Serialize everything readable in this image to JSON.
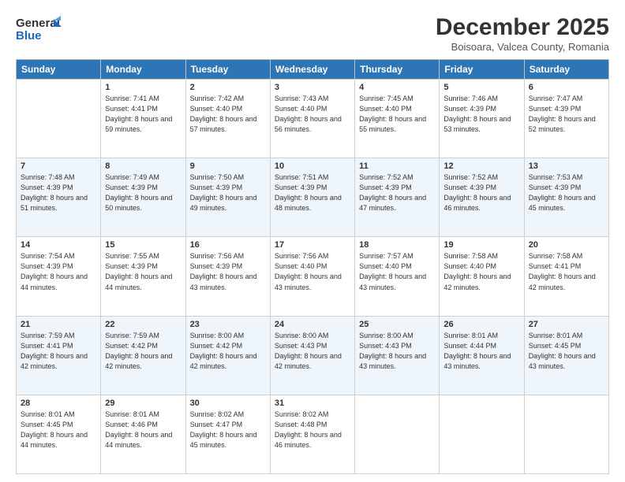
{
  "logo": {
    "line1": "General",
    "line2": "Blue"
  },
  "title": "December 2025",
  "subtitle": "Boisoara, Valcea County, Romania",
  "headers": [
    "Sunday",
    "Monday",
    "Tuesday",
    "Wednesday",
    "Thursday",
    "Friday",
    "Saturday"
  ],
  "weeks": [
    [
      {
        "day": "",
        "sunrise": "",
        "sunset": "",
        "daylight": ""
      },
      {
        "day": "1",
        "sunrise": "Sunrise: 7:41 AM",
        "sunset": "Sunset: 4:41 PM",
        "daylight": "Daylight: 8 hours and 59 minutes."
      },
      {
        "day": "2",
        "sunrise": "Sunrise: 7:42 AM",
        "sunset": "Sunset: 4:40 PM",
        "daylight": "Daylight: 8 hours and 57 minutes."
      },
      {
        "day": "3",
        "sunrise": "Sunrise: 7:43 AM",
        "sunset": "Sunset: 4:40 PM",
        "daylight": "Daylight: 8 hours and 56 minutes."
      },
      {
        "day": "4",
        "sunrise": "Sunrise: 7:45 AM",
        "sunset": "Sunset: 4:40 PM",
        "daylight": "Daylight: 8 hours and 55 minutes."
      },
      {
        "day": "5",
        "sunrise": "Sunrise: 7:46 AM",
        "sunset": "Sunset: 4:39 PM",
        "daylight": "Daylight: 8 hours and 53 minutes."
      },
      {
        "day": "6",
        "sunrise": "Sunrise: 7:47 AM",
        "sunset": "Sunset: 4:39 PM",
        "daylight": "Daylight: 8 hours and 52 minutes."
      }
    ],
    [
      {
        "day": "7",
        "sunrise": "Sunrise: 7:48 AM",
        "sunset": "Sunset: 4:39 PM",
        "daylight": "Daylight: 8 hours and 51 minutes."
      },
      {
        "day": "8",
        "sunrise": "Sunrise: 7:49 AM",
        "sunset": "Sunset: 4:39 PM",
        "daylight": "Daylight: 8 hours and 50 minutes."
      },
      {
        "day": "9",
        "sunrise": "Sunrise: 7:50 AM",
        "sunset": "Sunset: 4:39 PM",
        "daylight": "Daylight: 8 hours and 49 minutes."
      },
      {
        "day": "10",
        "sunrise": "Sunrise: 7:51 AM",
        "sunset": "Sunset: 4:39 PM",
        "daylight": "Daylight: 8 hours and 48 minutes."
      },
      {
        "day": "11",
        "sunrise": "Sunrise: 7:52 AM",
        "sunset": "Sunset: 4:39 PM",
        "daylight": "Daylight: 8 hours and 47 minutes."
      },
      {
        "day": "12",
        "sunrise": "Sunrise: 7:52 AM",
        "sunset": "Sunset: 4:39 PM",
        "daylight": "Daylight: 8 hours and 46 minutes."
      },
      {
        "day": "13",
        "sunrise": "Sunrise: 7:53 AM",
        "sunset": "Sunset: 4:39 PM",
        "daylight": "Daylight: 8 hours and 45 minutes."
      }
    ],
    [
      {
        "day": "14",
        "sunrise": "Sunrise: 7:54 AM",
        "sunset": "Sunset: 4:39 PM",
        "daylight": "Daylight: 8 hours and 44 minutes."
      },
      {
        "day": "15",
        "sunrise": "Sunrise: 7:55 AM",
        "sunset": "Sunset: 4:39 PM",
        "daylight": "Daylight: 8 hours and 44 minutes."
      },
      {
        "day": "16",
        "sunrise": "Sunrise: 7:56 AM",
        "sunset": "Sunset: 4:39 PM",
        "daylight": "Daylight: 8 hours and 43 minutes."
      },
      {
        "day": "17",
        "sunrise": "Sunrise: 7:56 AM",
        "sunset": "Sunset: 4:40 PM",
        "daylight": "Daylight: 8 hours and 43 minutes."
      },
      {
        "day": "18",
        "sunrise": "Sunrise: 7:57 AM",
        "sunset": "Sunset: 4:40 PM",
        "daylight": "Daylight: 8 hours and 43 minutes."
      },
      {
        "day": "19",
        "sunrise": "Sunrise: 7:58 AM",
        "sunset": "Sunset: 4:40 PM",
        "daylight": "Daylight: 8 hours and 42 minutes."
      },
      {
        "day": "20",
        "sunrise": "Sunrise: 7:58 AM",
        "sunset": "Sunset: 4:41 PM",
        "daylight": "Daylight: 8 hours and 42 minutes."
      }
    ],
    [
      {
        "day": "21",
        "sunrise": "Sunrise: 7:59 AM",
        "sunset": "Sunset: 4:41 PM",
        "daylight": "Daylight: 8 hours and 42 minutes."
      },
      {
        "day": "22",
        "sunrise": "Sunrise: 7:59 AM",
        "sunset": "Sunset: 4:42 PM",
        "daylight": "Daylight: 8 hours and 42 minutes."
      },
      {
        "day": "23",
        "sunrise": "Sunrise: 8:00 AM",
        "sunset": "Sunset: 4:42 PM",
        "daylight": "Daylight: 8 hours and 42 minutes."
      },
      {
        "day": "24",
        "sunrise": "Sunrise: 8:00 AM",
        "sunset": "Sunset: 4:43 PM",
        "daylight": "Daylight: 8 hours and 42 minutes."
      },
      {
        "day": "25",
        "sunrise": "Sunrise: 8:00 AM",
        "sunset": "Sunset: 4:43 PM",
        "daylight": "Daylight: 8 hours and 43 minutes."
      },
      {
        "day": "26",
        "sunrise": "Sunrise: 8:01 AM",
        "sunset": "Sunset: 4:44 PM",
        "daylight": "Daylight: 8 hours and 43 minutes."
      },
      {
        "day": "27",
        "sunrise": "Sunrise: 8:01 AM",
        "sunset": "Sunset: 4:45 PM",
        "daylight": "Daylight: 8 hours and 43 minutes."
      }
    ],
    [
      {
        "day": "28",
        "sunrise": "Sunrise: 8:01 AM",
        "sunset": "Sunset: 4:45 PM",
        "daylight": "Daylight: 8 hours and 44 minutes."
      },
      {
        "day": "29",
        "sunrise": "Sunrise: 8:01 AM",
        "sunset": "Sunset: 4:46 PM",
        "daylight": "Daylight: 8 hours and 44 minutes."
      },
      {
        "day": "30",
        "sunrise": "Sunrise: 8:02 AM",
        "sunset": "Sunset: 4:47 PM",
        "daylight": "Daylight: 8 hours and 45 minutes."
      },
      {
        "day": "31",
        "sunrise": "Sunrise: 8:02 AM",
        "sunset": "Sunset: 4:48 PM",
        "daylight": "Daylight: 8 hours and 46 minutes."
      },
      {
        "day": "",
        "sunrise": "",
        "sunset": "",
        "daylight": ""
      },
      {
        "day": "",
        "sunrise": "",
        "sunset": "",
        "daylight": ""
      },
      {
        "day": "",
        "sunrise": "",
        "sunset": "",
        "daylight": ""
      }
    ]
  ]
}
